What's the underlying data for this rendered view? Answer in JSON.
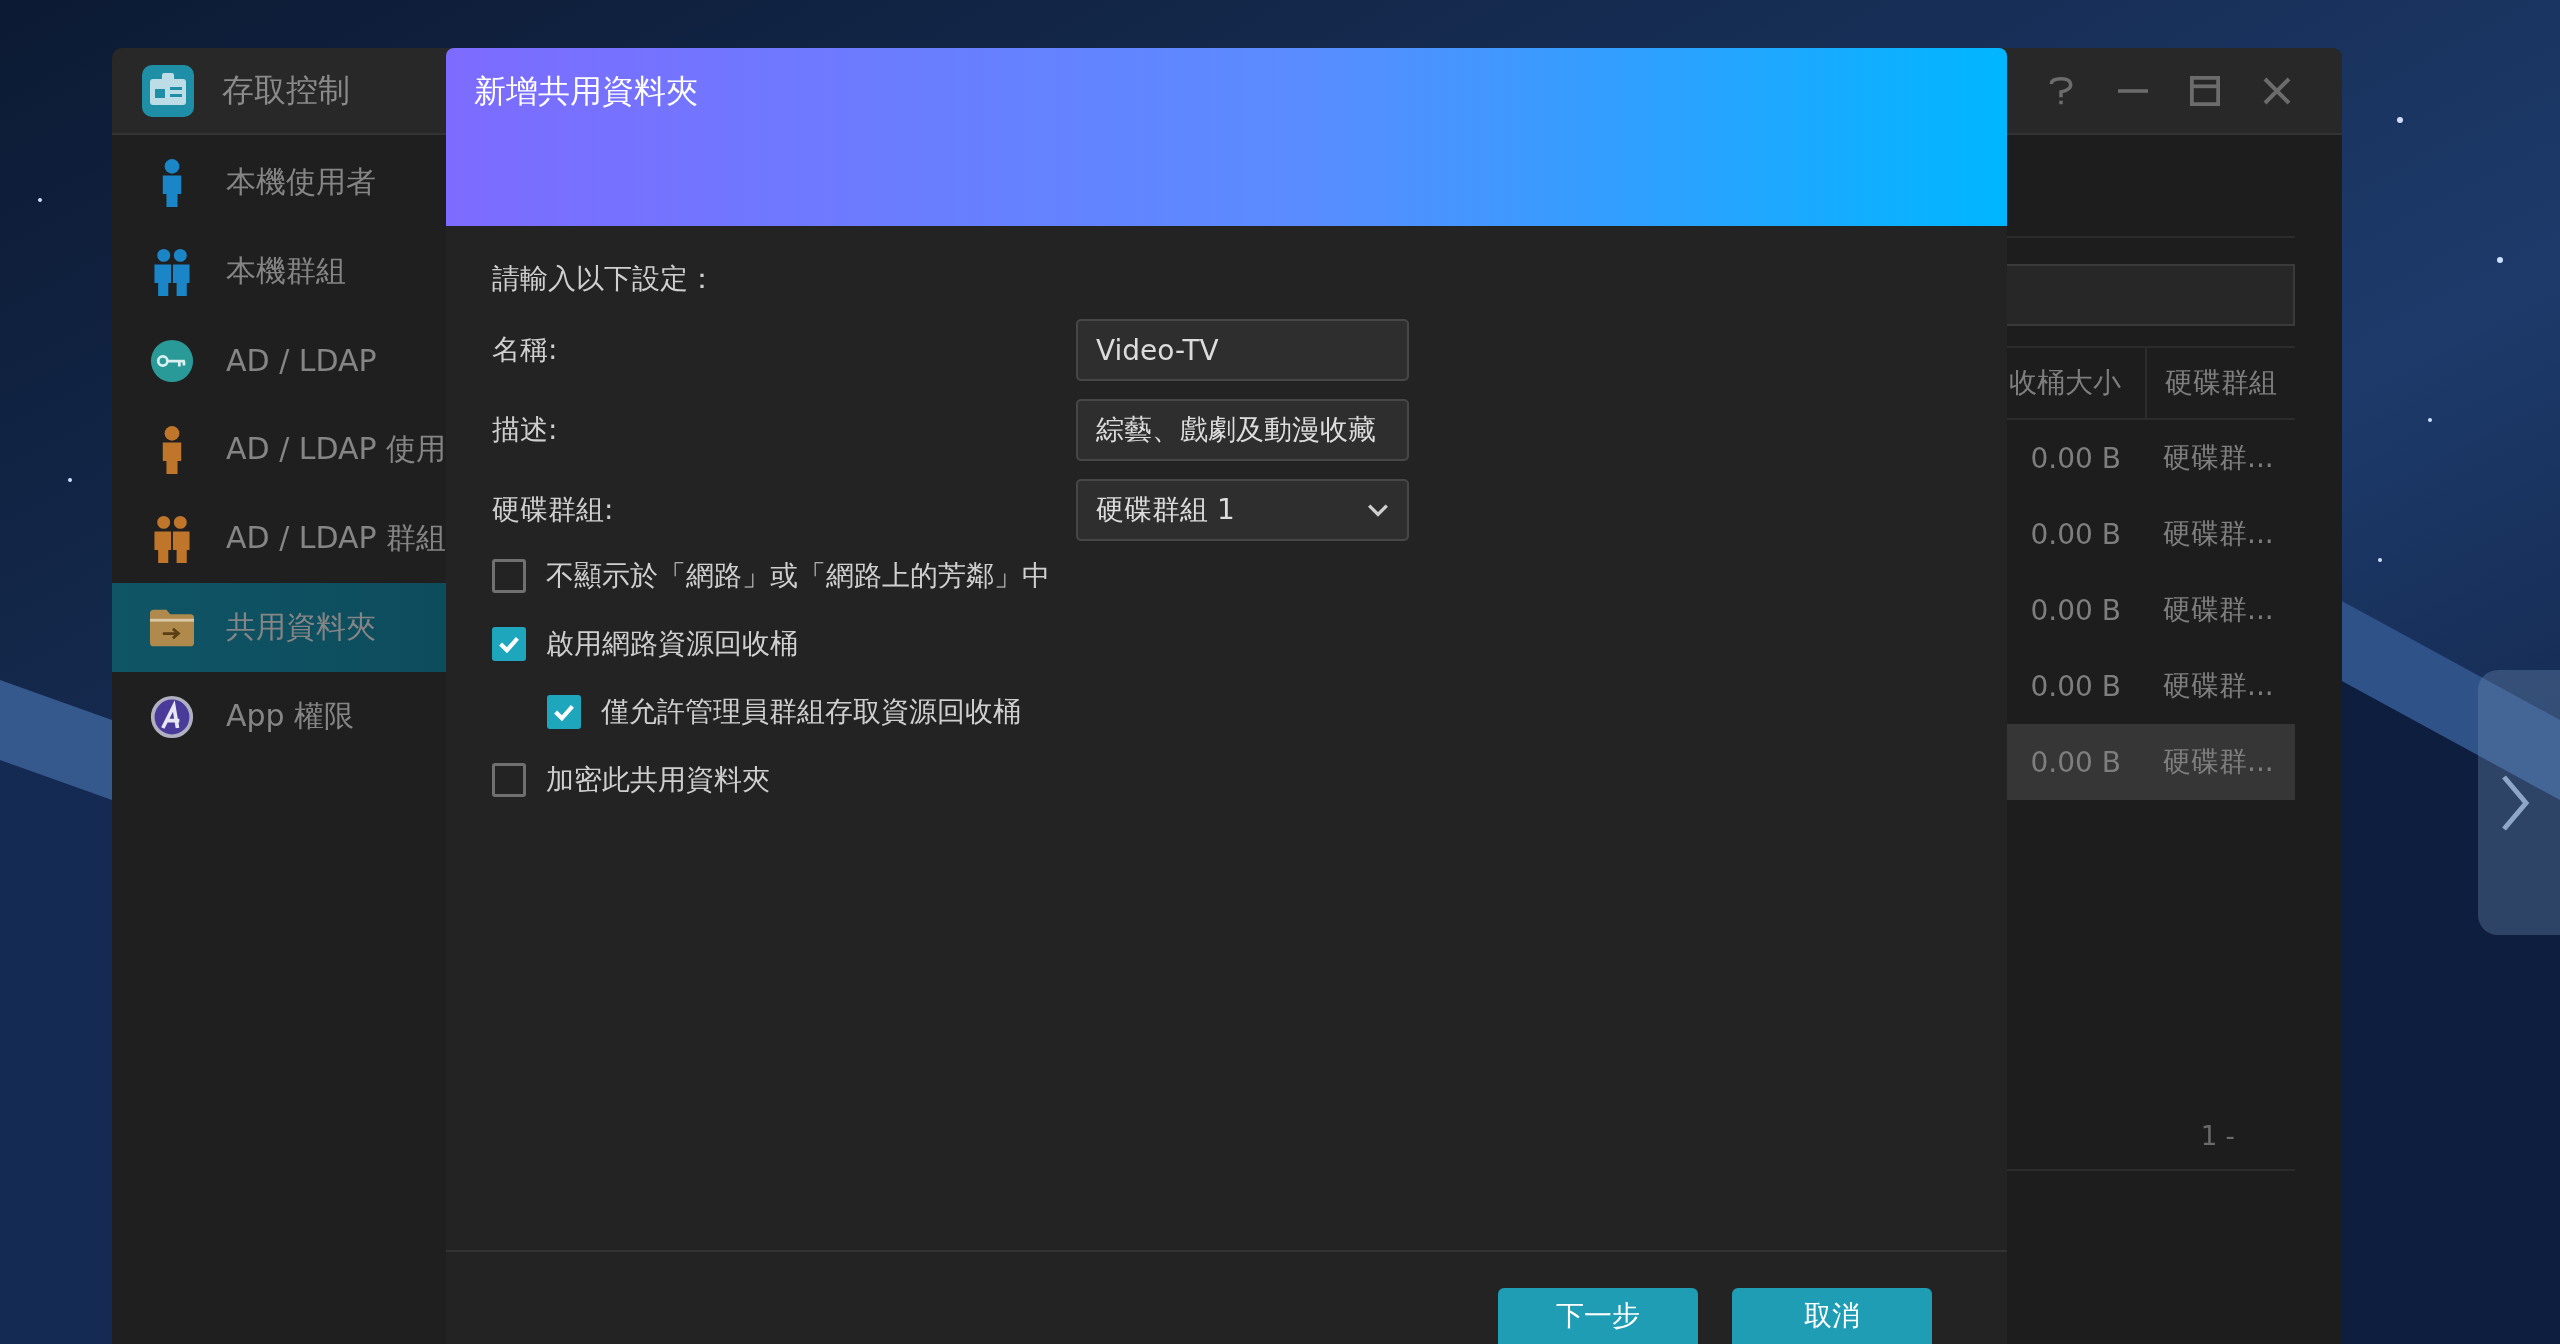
{
  "window": {
    "title": "存取控制"
  },
  "sidebar": {
    "items": [
      {
        "label": "本機使用者",
        "kind": "user",
        "selected": false
      },
      {
        "label": "本機群組",
        "kind": "group",
        "selected": false
      },
      {
        "label": "AD / LDAP",
        "kind": "key",
        "selected": false
      },
      {
        "label": "AD / LDAP 使用",
        "kind": "ad-user",
        "selected": false
      },
      {
        "label": "AD / LDAP 群組",
        "kind": "ad-group",
        "selected": false
      },
      {
        "label": "共用資料夾",
        "kind": "folder",
        "selected": true
      },
      {
        "label": "App 權限",
        "kind": "app",
        "selected": false
      }
    ]
  },
  "table": {
    "columns": [
      "收桶大小",
      "硬碟群組"
    ],
    "rows": [
      {
        "cells": [
          "0.00 B",
          "硬碟群..."
        ],
        "selected": false
      },
      {
        "cells": [
          "0.00 B",
          "硬碟群..."
        ],
        "selected": false
      },
      {
        "cells": [
          "0.00 B",
          "硬碟群..."
        ],
        "selected": false
      },
      {
        "cells": [
          "0.00 B",
          "硬碟群..."
        ],
        "selected": false
      },
      {
        "cells": [
          "0.00 B",
          "硬碟群..."
        ],
        "selected": true
      }
    ],
    "pagination": "1 -"
  },
  "dialog": {
    "title": "新增共用資料夾",
    "prompt": "請輸入以下設定：",
    "fields": [
      {
        "label": "名稱:",
        "value": "Video-TV",
        "kind": "text"
      },
      {
        "label": "描述:",
        "value": "綜藝、戲劇及動漫收藏",
        "kind": "text"
      },
      {
        "label": "硬碟群組:",
        "value": "硬碟群組 1",
        "kind": "select"
      }
    ],
    "options": [
      {
        "label": "不顯示於「網路」或「網路上的芳鄰」中",
        "checked": false
      },
      {
        "label": "啟用網路資源回收桶",
        "checked": true,
        "children": [
          {
            "label": "僅允許管理員群組存取資源回收桶",
            "checked": true
          }
        ]
      },
      {
        "label": "加密此共用資料夾",
        "checked": false
      }
    ],
    "buttons": [
      "下一步",
      "取消"
    ]
  }
}
